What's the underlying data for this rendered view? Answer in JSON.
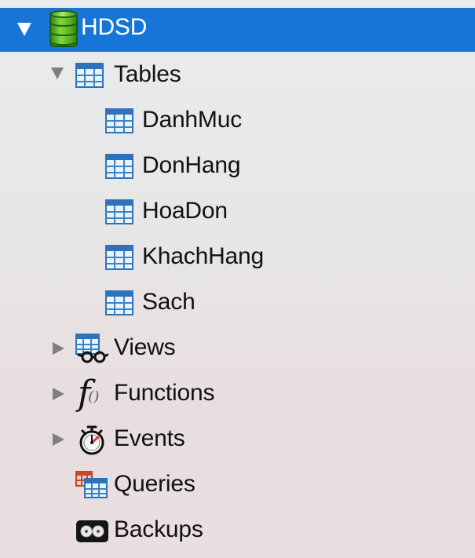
{
  "tree": {
    "root": {
      "label": "HDSD",
      "icon": "database-icon",
      "expanded": true,
      "selected": true
    },
    "tables": {
      "label": "Tables",
      "icon": "table-icon",
      "expanded": true,
      "items": [
        {
          "label": "DanhMuc",
          "icon": "table-icon"
        },
        {
          "label": "DonHang",
          "icon": "table-icon"
        },
        {
          "label": "HoaDon",
          "icon": "table-icon"
        },
        {
          "label": "KhachHang",
          "icon": "table-icon"
        },
        {
          "label": "Sach",
          "icon": "table-icon"
        }
      ]
    },
    "groups": [
      {
        "label": "Views",
        "icon": "views-icon",
        "expanded": false
      },
      {
        "label": "Functions",
        "icon": "functions-icon",
        "expanded": false
      },
      {
        "label": "Events",
        "icon": "events-icon",
        "expanded": false
      },
      {
        "label": "Queries",
        "icon": "queries-icon"
      },
      {
        "label": "Backups",
        "icon": "backups-icon"
      }
    ]
  },
  "colors": {
    "selection": "#1775d8",
    "text": "#111111",
    "disclosure": "#7f7f7f"
  }
}
